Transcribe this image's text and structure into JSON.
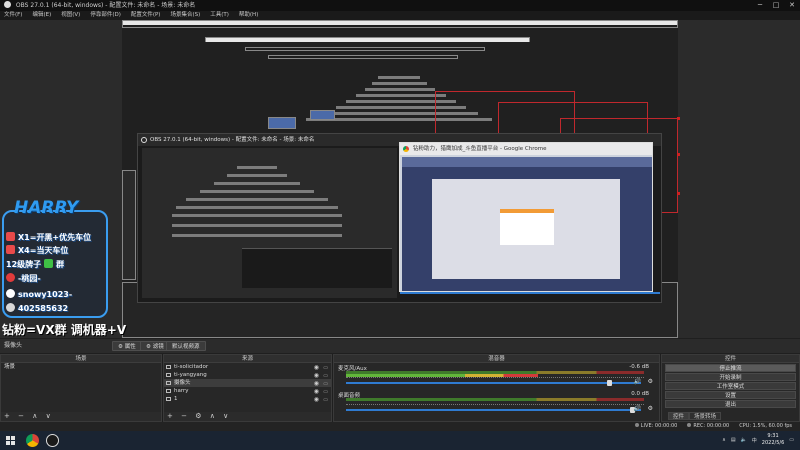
{
  "window": {
    "title": "OBS 27.0.1 (64-bit, windows) - 配置文件: 未命名 - 场景: 未命名",
    "minimize": "─",
    "maximize": "□",
    "close": "✕"
  },
  "menu": [
    "文件(F)",
    "编辑(E)",
    "视图(V)",
    "停靠部件(D)",
    "配置文件(P)",
    "场景集合(S)",
    "工具(T)",
    "帮助(H)"
  ],
  "inner_obs": {
    "title": "OBS 27.0.1 (64-bit, windows) - 配置文件: 未命名 - 场景: 未命名"
  },
  "chrome": {
    "title": "钻粉助力，猎鹰加成_斗鱼直播平台 - Google Chrome"
  },
  "overlay": {
    "logo": "HARRY",
    "lines": [
      "X1=开黑+优先车位",
      "X4=当天车位",
      "12级牌子",
      "群",
      "-桃园-",
      "snowy1023-",
      "402585632"
    ],
    "banner": "钻粉=VX群 调机器+V"
  },
  "scene_toolbar": {
    "label": "摄像头",
    "properties": "属性",
    "filters": "滤镜",
    "default_capture": "默认视频源"
  },
  "docks": {
    "scenes": {
      "title": "场景",
      "items": [
        "场景"
      ]
    },
    "sources": {
      "title": "来源",
      "items": [
        {
          "name": "ti-solicitador",
          "type": "text",
          "selected": false
        },
        {
          "name": "ti-yangyang",
          "type": "text",
          "selected": false
        },
        {
          "name": "摄像头",
          "type": "camera",
          "selected": true
        },
        {
          "name": "harry",
          "type": "image",
          "selected": false
        },
        {
          "name": "1",
          "type": "image",
          "selected": false
        }
      ]
    },
    "mixer": {
      "title": "混音器",
      "tracks": [
        {
          "name": "麦克风/Aux",
          "db": "-0.6 dB",
          "level": 0.9
        },
        {
          "name": "桌面音频",
          "db": "0.0 dB",
          "level": 0.98
        }
      ],
      "tick_labels": [
        "-60",
        "-55",
        "-50",
        "-45",
        "-40",
        "-35",
        "-30",
        "-25",
        "-20",
        "-15",
        "-10",
        "-5",
        "0"
      ]
    },
    "controls": {
      "title": "控件",
      "buttons": [
        "停止推流",
        "开始录制",
        "工作室模式",
        "设置",
        "退出"
      ],
      "active": 0,
      "tabs": [
        "控件",
        "场景转场"
      ]
    }
  },
  "footer_icons": {
    "add": "+",
    "remove": "−",
    "settings": "⚙",
    "up": "∧",
    "down": "∨"
  },
  "status": {
    "live_label": "LIVE:",
    "live_time": "00:00:00",
    "rec_label": "REC:",
    "rec_time": "00:00:00",
    "cpu": "CPU: 1.5%, 60.00 fps"
  },
  "taskbar": {
    "time": "9:31",
    "date": "2022/5/6",
    "lang": "中"
  }
}
